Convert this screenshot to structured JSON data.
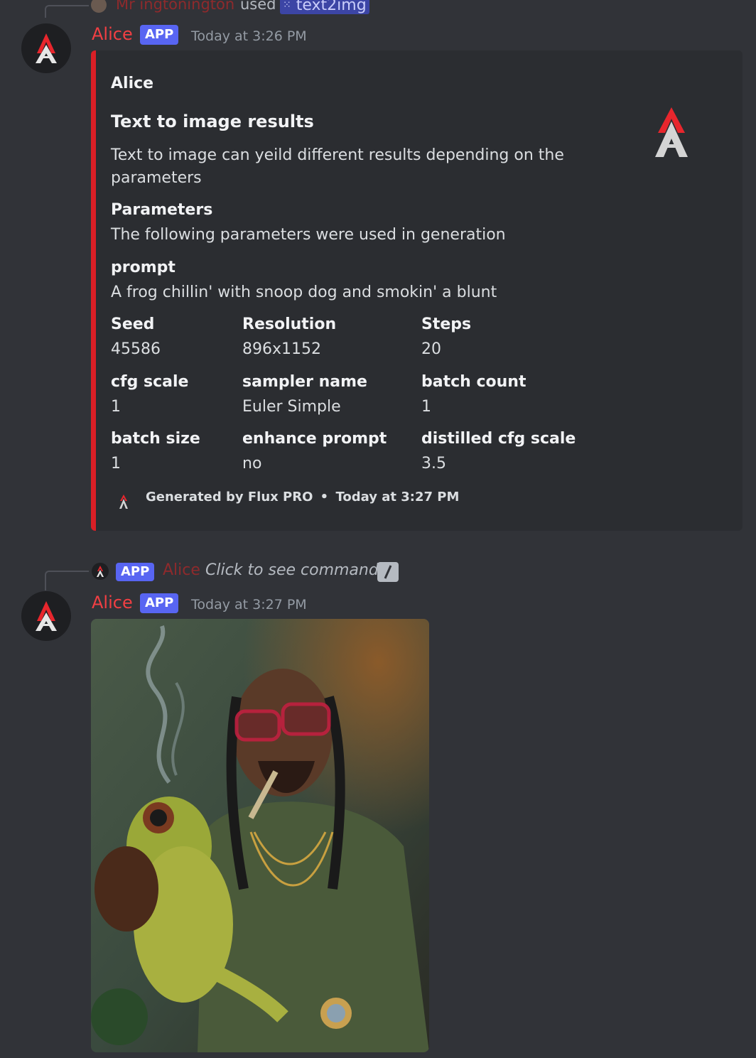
{
  "colors": {
    "background": "#313338",
    "embed_bg": "#2b2d31",
    "embed_accent": "#da1f26",
    "author_color": "#f23f43",
    "app_badge": "#5865f2",
    "timestamp": "#949ba4"
  },
  "message1": {
    "reply": {
      "user": "Mr ingtonington",
      "used_text": "used",
      "command": "text2img",
      "command_icon": "slash-apps-icon"
    },
    "author": "Alice",
    "badge": "APP",
    "timestamp": "Today at 3:26 PM",
    "embed": {
      "author_name": "Alice",
      "title": "Text to image results",
      "description_line1": "Text to image can yeild different results depending on the",
      "description_line2": "parameters",
      "thumbnail_icon": "alice-logo-icon",
      "params_heading": "Parameters",
      "params_text": "The following parameters were used in generation",
      "prompt_label": "prompt",
      "prompt_value": "A frog chillin' with snoop dog and smokin' a blunt",
      "fields": [
        {
          "name": "Seed",
          "value": "45586"
        },
        {
          "name": "Resolution",
          "value": "896x1152"
        },
        {
          "name": "Steps",
          "value": "20"
        },
        {
          "name": "cfg scale",
          "value": "1"
        },
        {
          "name": "sampler name",
          "value": "Euler Simple"
        },
        {
          "name": "batch count",
          "value": "1"
        },
        {
          "name": "batch size",
          "value": "1"
        },
        {
          "name": "enhance prompt",
          "value": "no"
        },
        {
          "name": "distilled cfg scale",
          "value": "3.5"
        }
      ],
      "footer_text": "Generated by Flux PRO",
      "footer_separator": "•",
      "footer_time": "Today at 3:27 PM"
    }
  },
  "message2": {
    "reply": {
      "badge": "APP",
      "user": "Alice",
      "action": "Click to see command"
    },
    "author": "Alice",
    "badge": "APP",
    "timestamp": "Today at 3:27 PM",
    "image_description_icon": "generated-image"
  }
}
